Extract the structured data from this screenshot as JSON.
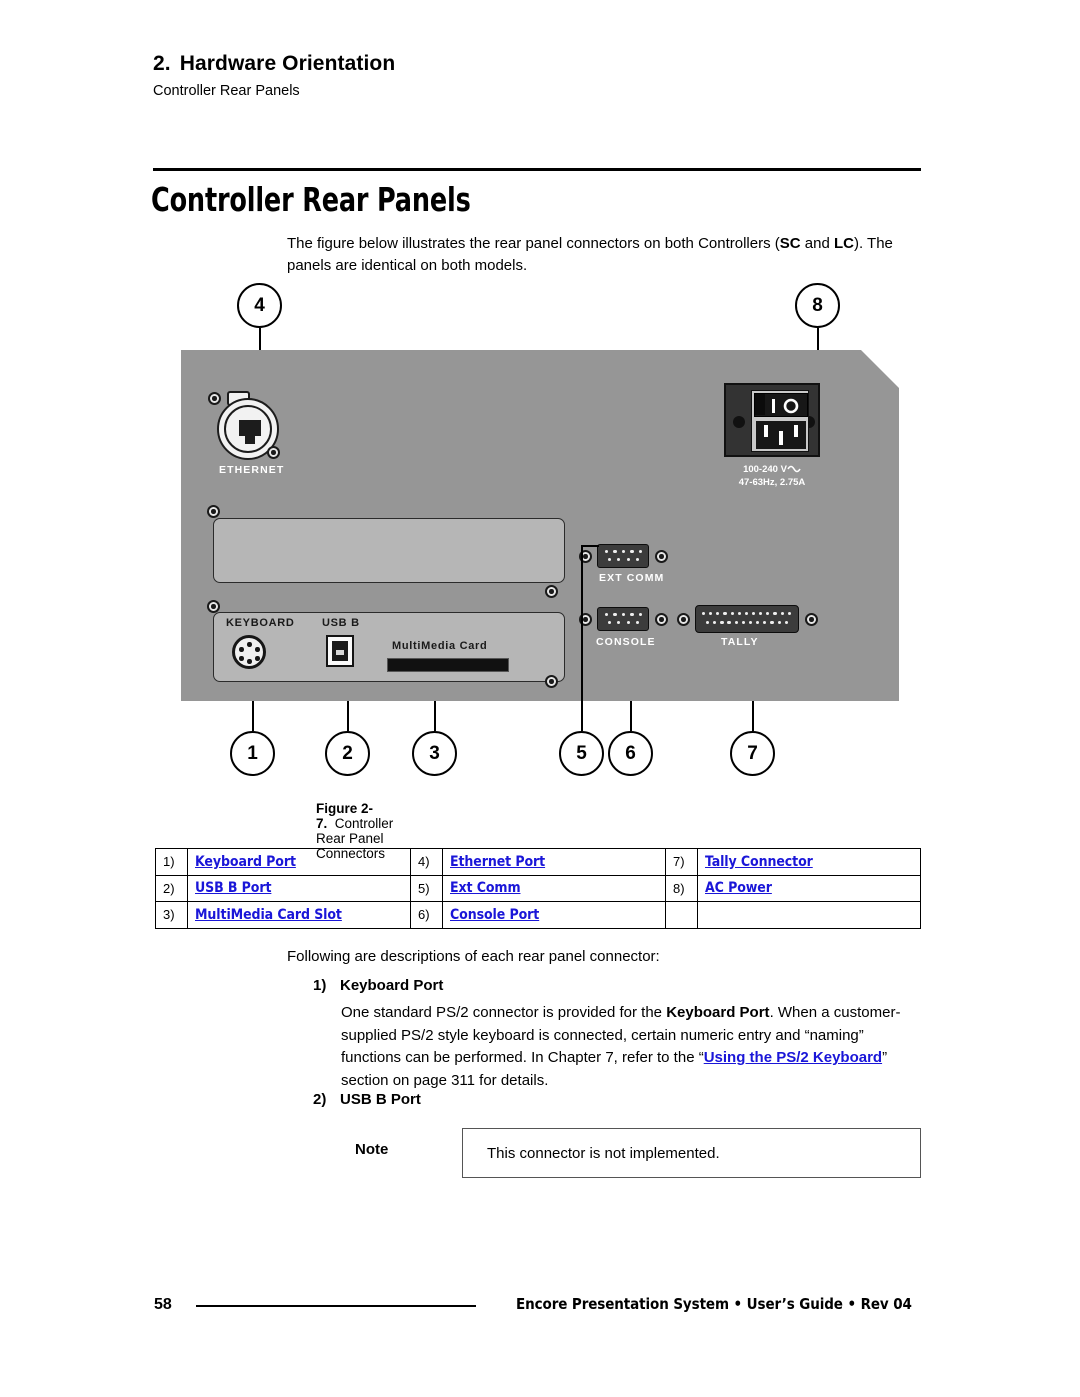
{
  "running_head": {
    "chapter_number": "2.",
    "chapter_title": "Hardware Orientation",
    "section": "Controller Rear Panels"
  },
  "page_title": "Controller Rear Panels",
  "intro_paragraph": "The figure below illustrates the rear panel connectors on both Controllers (SC and LC). The panels are identical on both models.",
  "intro_parts": {
    "a": "The figure below illustrates the rear panel connectors on both Controllers (",
    "sc": "SC",
    "and": " and ",
    "lc": "LC",
    "b": "). The panels are identical on both models."
  },
  "figure": {
    "caption_label": "Figure 2-7.",
    "caption_text": "Controller Rear Panel Connectors",
    "callouts": [
      "1",
      "2",
      "3",
      "4",
      "5",
      "6",
      "7",
      "8"
    ],
    "panel_labels": {
      "ethernet": "ETHERNET",
      "keyboard": "KEYBOARD",
      "usb_b": "USB B",
      "multimedia_card": "MultiMedia Card",
      "ext_comm": "EXT COMM",
      "console": "CONSOLE",
      "tally": "TALLY",
      "ac_line1": "100-240 V",
      "ac_line2": "47-63Hz, 2.75A"
    },
    "colors": {
      "panel_gray": "#969696",
      "subpanel_gray": "#b6b6b6",
      "stripe": "#ffffff",
      "connector_dark": "#3c3c3c"
    }
  },
  "legend_table": {
    "rows": [
      [
        {
          "num": "1)",
          "label": "Keyboard Port"
        },
        {
          "num": "4)",
          "label": "Ethernet Port"
        },
        {
          "num": "7)",
          "label": "Tally Connector"
        }
      ],
      [
        {
          "num": "2)",
          "label": "USB B Port"
        },
        {
          "num": "5)",
          "label": "Ext Comm"
        },
        {
          "num": "8)",
          "label": "AC Power"
        }
      ],
      [
        {
          "num": "3)",
          "label": "MultiMedia Card Slot"
        },
        {
          "num": "6)",
          "label": "Console Port"
        },
        {
          "num": "",
          "label": ""
        }
      ]
    ],
    "link_color": "#1a16d8"
  },
  "body": {
    "lead_in": "Following are descriptions of each rear panel connector:",
    "item1": {
      "marker": "1)",
      "title": "Keyboard Port"
    },
    "item1_paragraph": {
      "p1": "One standard PS/2 connector is provided for the ",
      "bold1": "Keyboard Port",
      "p2": ".  When a customer-supplied PS/2 style keyboard is connected, certain numeric entry and “naming” functions can be performed.  In Chapter 7, refer to the “",
      "link": "Using the PS/2 Keyboard",
      "p3": "” section on page 311 for details."
    },
    "item2": {
      "marker": "2)",
      "title": "USB B Port"
    }
  },
  "note": {
    "label": "Note",
    "text": "This connector is not implemented."
  },
  "footer": {
    "page_number": "58",
    "text": "Encore Presentation System  •  User’s Guide  •  Rev 04"
  }
}
